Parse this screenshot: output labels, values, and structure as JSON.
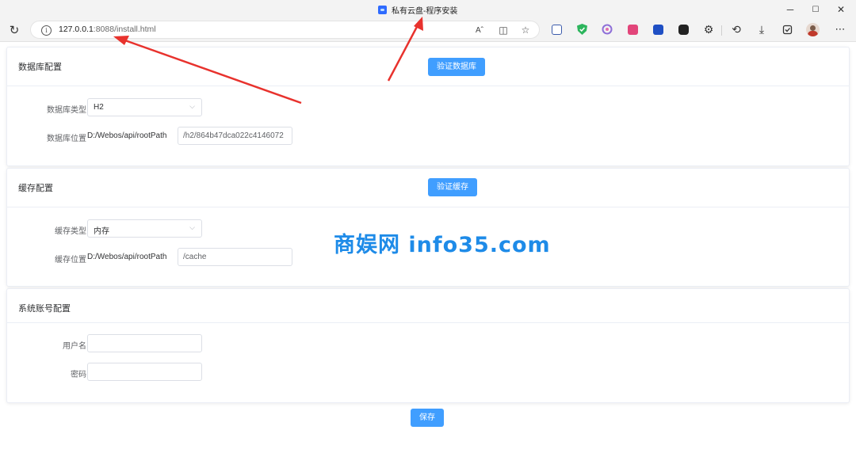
{
  "browser": {
    "tab_title": "私有云盘-程序安装",
    "url_host": "127.0.0.1",
    "url_rest": ":8088/install.html",
    "window_controls": {
      "minimize": "─",
      "maximize": "☐",
      "close": "✕"
    },
    "toolbar_icons": [
      "read-aloud-icon",
      "split-screen-icon",
      "favorite-star-icon"
    ],
    "extensions": [
      "calendar-icon",
      "shield-icon",
      "puzzle-extension-icon",
      "history-icon",
      "download-icon",
      "settings-more-icon"
    ]
  },
  "database": {
    "title": "数据库配置",
    "verify_button": "验证数据库",
    "type_label": "数据库类型",
    "type_value": "H2",
    "location_label": "数据库位置",
    "location_prefix": "D:/Webos/api/rootPath",
    "location_value": "/h2/864b47dca022c4146072"
  },
  "cache": {
    "title": "缓存配置",
    "verify_button": "验证缓存",
    "type_label": "缓存类型",
    "type_value": "内存",
    "location_label": "缓存位置",
    "location_prefix": "D:/Webos/api/rootPath",
    "location_value": "/cache"
  },
  "account": {
    "title": "系统账号配置",
    "username_label": "用户名",
    "username_value": "",
    "password_label": "密码",
    "password_value": ""
  },
  "save_button": "保存",
  "watermark": "商娱网 info35.com",
  "colors": {
    "primary": "#409eff",
    "annotation_arrow": "#e8322d",
    "watermark": "#1e8be8"
  }
}
